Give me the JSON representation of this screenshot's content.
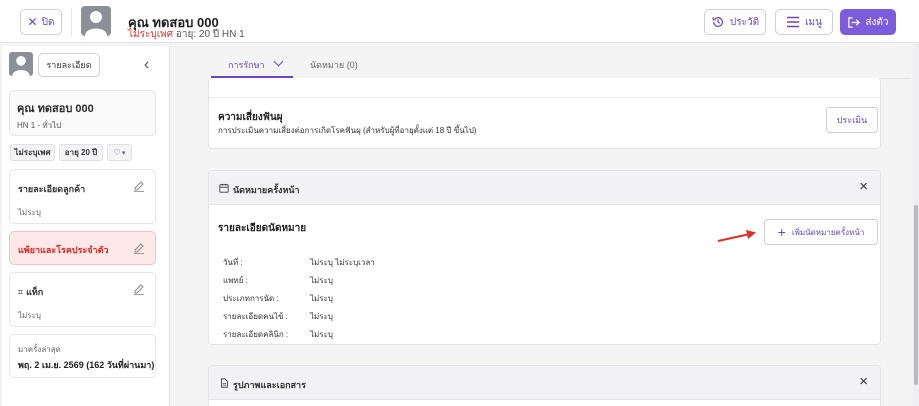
{
  "header": {
    "close_label": "ปิด",
    "patient_name": "คุณ ทดสอบ 000",
    "gender": "ไม่ระบุเพศ",
    "age_hn": "อายุ: 20 ปี  HN 1",
    "history_label": "ประวัติ",
    "menu_label": "เมนู",
    "send_label": "ส่งตัว"
  },
  "sidebar": {
    "detail_button": "รายละเอียด",
    "patient_name": "คุณ ทดสอบ 000",
    "hn_line": "HN 1 - ทั่วไป",
    "chips": [
      "ไม่ระบุเพศ",
      "อายุ 20 ปี"
    ],
    "customer_detail": {
      "title": "รายละเอียดลูกค้า",
      "value": "ไม่ระบุ"
    },
    "allergy": {
      "title": "แพ้ยาและโรคประจำตัว"
    },
    "tags": {
      "title": "แท็ก",
      "value": "ไม่ระบุ"
    },
    "last_visit": {
      "label": "มาครั้งล่าสุด",
      "value": "พฤ. 2 เม.ย. 2569 (162 วันที่ผ่านมา)"
    }
  },
  "tabs": [
    {
      "label": "การรักษา",
      "active": true
    },
    {
      "label": "นัดหมาย (0)",
      "active": false
    }
  ],
  "risk": {
    "title": "ความเสี่ยงฟันผุ",
    "description": "การประเมินความเสี่ยงต่อการเกิดโรคฟันผุ (สำหรับผู้ที่อายุตั้งแต่ 18 ปี ขึ้นไป)",
    "evaluate_label": "ประเมิน"
  },
  "next_appointment": {
    "title": "นัดหมายครั้งหน้า",
    "subtitle": "รายละเอียดนัดหมาย",
    "add_label": "เพิ่มนัดหมายครั้งหน้า",
    "rows": [
      {
        "key": "วันที่ :",
        "value": "ไม่ระบุ  ไม่ระบุเวลา"
      },
      {
        "key": "แพทย์ :",
        "value": "ไม่ระบุ"
      },
      {
        "key": "ประเภทการนัด :",
        "value": "ไม่ระบุ"
      },
      {
        "key": "รายละเอียดคนไข้ :",
        "value": "ไม่ระบุ"
      },
      {
        "key": "รายละเอียดคลินิก :",
        "value": "ไม่ระบุ"
      }
    ]
  },
  "documents": {
    "title": "รูปภาพและเอกสาร"
  },
  "colors": {
    "accent": "#7c5cdb",
    "danger": "#e03131",
    "arrow": "#d93030"
  }
}
